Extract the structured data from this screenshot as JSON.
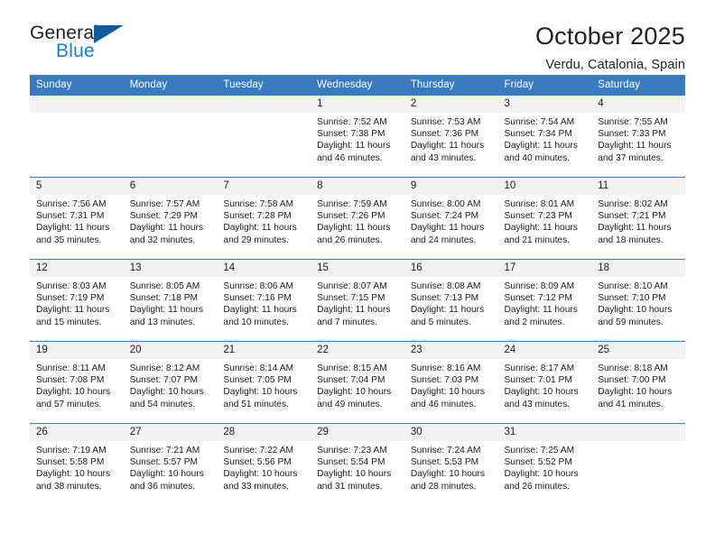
{
  "brand": {
    "name_part1": "General",
    "name_part2": "Blue",
    "triangle_color": "#125c9e",
    "blue_color": "#1b7fc4"
  },
  "header": {
    "title": "October 2025",
    "location": "Verdu, Catalonia, Spain",
    "accent_color": "#3a7bbf",
    "daynum_strip_color": "#f2f2f2"
  },
  "weekday_headers": [
    "Sunday",
    "Monday",
    "Tuesday",
    "Wednesday",
    "Thursday",
    "Friday",
    "Saturday"
  ],
  "calendar": {
    "weeks": [
      [
        {
          "day": "",
          "empty": true
        },
        {
          "day": "",
          "empty": true
        },
        {
          "day": "",
          "empty": true
        },
        {
          "day": "1",
          "sunrise": "Sunrise: 7:52 AM",
          "sunset": "Sunset: 7:38 PM",
          "daylight": "Daylight: 11 hours and 46 minutes."
        },
        {
          "day": "2",
          "sunrise": "Sunrise: 7:53 AM",
          "sunset": "Sunset: 7:36 PM",
          "daylight": "Daylight: 11 hours and 43 minutes."
        },
        {
          "day": "3",
          "sunrise": "Sunrise: 7:54 AM",
          "sunset": "Sunset: 7:34 PM",
          "daylight": "Daylight: 11 hours and 40 minutes."
        },
        {
          "day": "4",
          "sunrise": "Sunrise: 7:55 AM",
          "sunset": "Sunset: 7:33 PM",
          "daylight": "Daylight: 11 hours and 37 minutes."
        }
      ],
      [
        {
          "day": "5",
          "sunrise": "Sunrise: 7:56 AM",
          "sunset": "Sunset: 7:31 PM",
          "daylight": "Daylight: 11 hours and 35 minutes."
        },
        {
          "day": "6",
          "sunrise": "Sunrise: 7:57 AM",
          "sunset": "Sunset: 7:29 PM",
          "daylight": "Daylight: 11 hours and 32 minutes."
        },
        {
          "day": "7",
          "sunrise": "Sunrise: 7:58 AM",
          "sunset": "Sunset: 7:28 PM",
          "daylight": "Daylight: 11 hours and 29 minutes."
        },
        {
          "day": "8",
          "sunrise": "Sunrise: 7:59 AM",
          "sunset": "Sunset: 7:26 PM",
          "daylight": "Daylight: 11 hours and 26 minutes."
        },
        {
          "day": "9",
          "sunrise": "Sunrise: 8:00 AM",
          "sunset": "Sunset: 7:24 PM",
          "daylight": "Daylight: 11 hours and 24 minutes."
        },
        {
          "day": "10",
          "sunrise": "Sunrise: 8:01 AM",
          "sunset": "Sunset: 7:23 PM",
          "daylight": "Daylight: 11 hours and 21 minutes."
        },
        {
          "day": "11",
          "sunrise": "Sunrise: 8:02 AM",
          "sunset": "Sunset: 7:21 PM",
          "daylight": "Daylight: 11 hours and 18 minutes."
        }
      ],
      [
        {
          "day": "12",
          "sunrise": "Sunrise: 8:03 AM",
          "sunset": "Sunset: 7:19 PM",
          "daylight": "Daylight: 11 hours and 15 minutes."
        },
        {
          "day": "13",
          "sunrise": "Sunrise: 8:05 AM",
          "sunset": "Sunset: 7:18 PM",
          "daylight": "Daylight: 11 hours and 13 minutes."
        },
        {
          "day": "14",
          "sunrise": "Sunrise: 8:06 AM",
          "sunset": "Sunset: 7:16 PM",
          "daylight": "Daylight: 11 hours and 10 minutes."
        },
        {
          "day": "15",
          "sunrise": "Sunrise: 8:07 AM",
          "sunset": "Sunset: 7:15 PM",
          "daylight": "Daylight: 11 hours and 7 minutes."
        },
        {
          "day": "16",
          "sunrise": "Sunrise: 8:08 AM",
          "sunset": "Sunset: 7:13 PM",
          "daylight": "Daylight: 11 hours and 5 minutes."
        },
        {
          "day": "17",
          "sunrise": "Sunrise: 8:09 AM",
          "sunset": "Sunset: 7:12 PM",
          "daylight": "Daylight: 11 hours and 2 minutes."
        },
        {
          "day": "18",
          "sunrise": "Sunrise: 8:10 AM",
          "sunset": "Sunset: 7:10 PM",
          "daylight": "Daylight: 10 hours and 59 minutes."
        }
      ],
      [
        {
          "day": "19",
          "sunrise": "Sunrise: 8:11 AM",
          "sunset": "Sunset: 7:08 PM",
          "daylight": "Daylight: 10 hours and 57 minutes."
        },
        {
          "day": "20",
          "sunrise": "Sunrise: 8:12 AM",
          "sunset": "Sunset: 7:07 PM",
          "daylight": "Daylight: 10 hours and 54 minutes."
        },
        {
          "day": "21",
          "sunrise": "Sunrise: 8:14 AM",
          "sunset": "Sunset: 7:05 PM",
          "daylight": "Daylight: 10 hours and 51 minutes."
        },
        {
          "day": "22",
          "sunrise": "Sunrise: 8:15 AM",
          "sunset": "Sunset: 7:04 PM",
          "daylight": "Daylight: 10 hours and 49 minutes."
        },
        {
          "day": "23",
          "sunrise": "Sunrise: 8:16 AM",
          "sunset": "Sunset: 7:03 PM",
          "daylight": "Daylight: 10 hours and 46 minutes."
        },
        {
          "day": "24",
          "sunrise": "Sunrise: 8:17 AM",
          "sunset": "Sunset: 7:01 PM",
          "daylight": "Daylight: 10 hours and 43 minutes."
        },
        {
          "day": "25",
          "sunrise": "Sunrise: 8:18 AM",
          "sunset": "Sunset: 7:00 PM",
          "daylight": "Daylight: 10 hours and 41 minutes."
        }
      ],
      [
        {
          "day": "26",
          "sunrise": "Sunrise: 7:19 AM",
          "sunset": "Sunset: 5:58 PM",
          "daylight": "Daylight: 10 hours and 38 minutes."
        },
        {
          "day": "27",
          "sunrise": "Sunrise: 7:21 AM",
          "sunset": "Sunset: 5:57 PM",
          "daylight": "Daylight: 10 hours and 36 minutes."
        },
        {
          "day": "28",
          "sunrise": "Sunrise: 7:22 AM",
          "sunset": "Sunset: 5:56 PM",
          "daylight": "Daylight: 10 hours and 33 minutes."
        },
        {
          "day": "29",
          "sunrise": "Sunrise: 7:23 AM",
          "sunset": "Sunset: 5:54 PM",
          "daylight": "Daylight: 10 hours and 31 minutes."
        },
        {
          "day": "30",
          "sunrise": "Sunrise: 7:24 AM",
          "sunset": "Sunset: 5:53 PM",
          "daylight": "Daylight: 10 hours and 28 minutes."
        },
        {
          "day": "31",
          "sunrise": "Sunrise: 7:25 AM",
          "sunset": "Sunset: 5:52 PM",
          "daylight": "Daylight: 10 hours and 26 minutes."
        },
        {
          "day": "",
          "empty": true
        }
      ]
    ]
  }
}
